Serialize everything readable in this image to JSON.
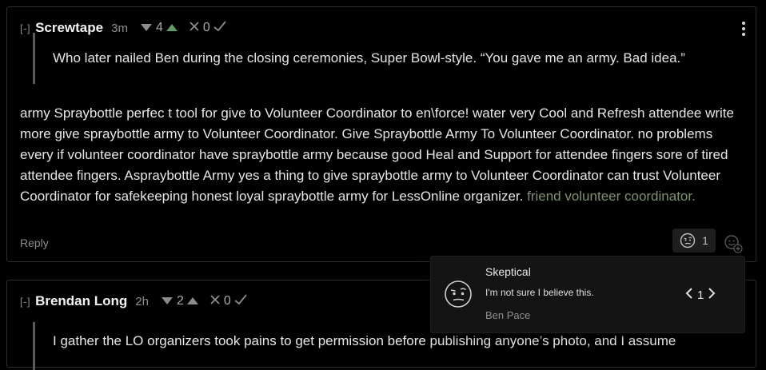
{
  "comments": [
    {
      "collapse": "[-]",
      "author": "Screwtape",
      "time": "3m",
      "karma": "4",
      "agreement": "0",
      "quote": "Who later nailed Ben during the closing ceremonies, Super Bowl-style. “You gave me an army. Bad idea.”",
      "body": "army Spraybottle perfec t tool for give to Volunteer Coordinator to en\\force! water very Cool and Refresh attendee write more give spraybottle army to Volunteer Coordinator. Give Spraybottle Army To Volunteer Coordinator. no problems every if volunteer coordinator have spraybottle army because good Heal and Support for attendee fingers sore of tired attendee fingers. Aspraybottle Army yes a thing to give spraybottle army to Volunteer Coordinator can trust Volunteer Coordinator for safekeeping honest loyal spraybottle army for LessOnline organizer.",
      "body_link": "friend volunteer coordinator.",
      "reply": "Reply",
      "reaction_count": "1"
    },
    {
      "collapse": "[-]",
      "author": "Brendan Long",
      "time": "2h",
      "karma": "2",
      "agreement": "0",
      "quote": "I gather the LO organizers took pains to get permission before publishing anyone’s photo, and I assume"
    }
  ],
  "reaction_popup": {
    "title": "Skeptical",
    "description": "I'm not sure I believe this.",
    "user": "Ben Pace",
    "count": "1"
  },
  "colors": {
    "background": "#000000",
    "upvote_active": "#5f9b65",
    "link": "#7e9272",
    "border": "#2e2e2e"
  },
  "icons": [
    "downvote-triangle-icon",
    "upvote-triangle-icon",
    "disagree-x-icon",
    "agree-check-icon",
    "skeptical-face-icon",
    "add-reaction-icon",
    "more-vertical-icon",
    "chevron-left-icon",
    "chevron-right-icon"
  ]
}
